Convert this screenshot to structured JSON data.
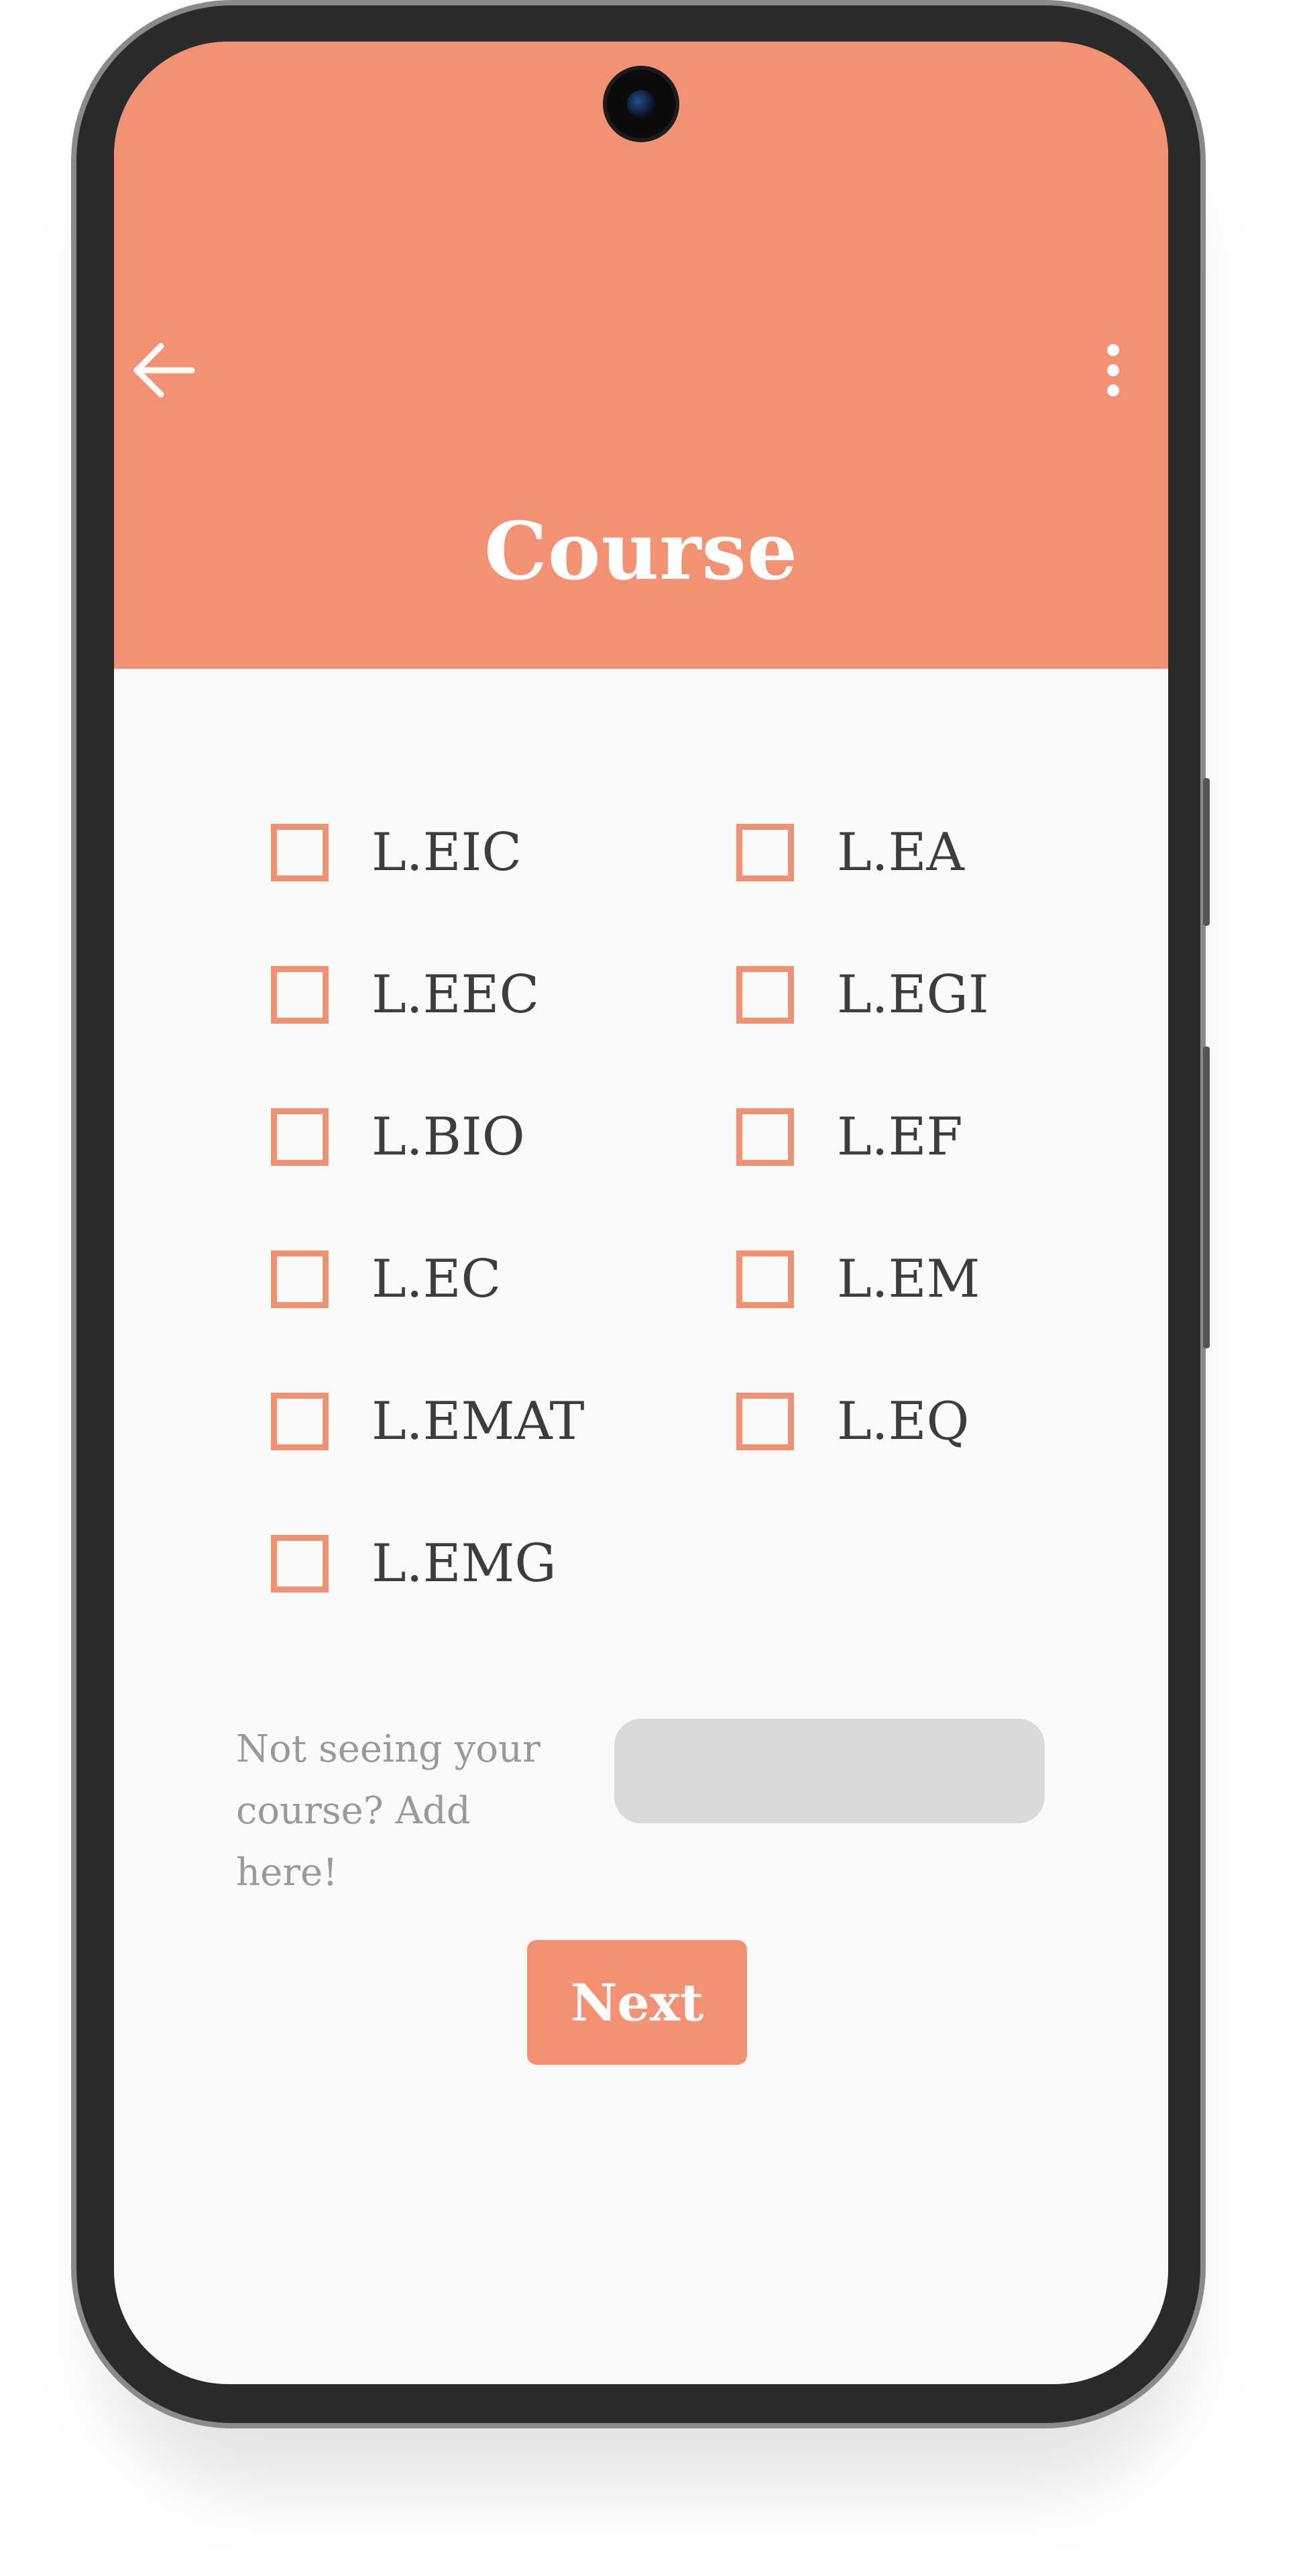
{
  "header": {
    "title": "Course",
    "background_color": "#f29174",
    "back_icon": "arrow-left-icon",
    "menu_icon": "more-vertical-icon"
  },
  "courses": [
    {
      "label": "L.EIC",
      "checked": false
    },
    {
      "label": "L.EA",
      "checked": false
    },
    {
      "label": "L.EEC",
      "checked": false
    },
    {
      "label": "L.EGI",
      "checked": false
    },
    {
      "label": "L.BIO",
      "checked": false
    },
    {
      "label": "L.EF",
      "checked": false
    },
    {
      "label": "L.EC",
      "checked": false
    },
    {
      "label": "L.EM",
      "checked": false
    },
    {
      "label": "L.EMAT",
      "checked": false
    },
    {
      "label": "L.EQ",
      "checked": false
    },
    {
      "label": "L.EMG",
      "checked": false
    }
  ],
  "add_course": {
    "hint_line1": "Not seeing your",
    "hint_line2": "course? Add here!",
    "value": "",
    "placeholder": ""
  },
  "next_button": {
    "label": "Next"
  },
  "colors": {
    "accent": "#f29174",
    "checkbox_border": "#ee9274",
    "text": "#3d3d3d",
    "hint_text": "#9a9a9a",
    "input_bg": "#d9d9d9",
    "screen_bg": "#fafafa"
  }
}
